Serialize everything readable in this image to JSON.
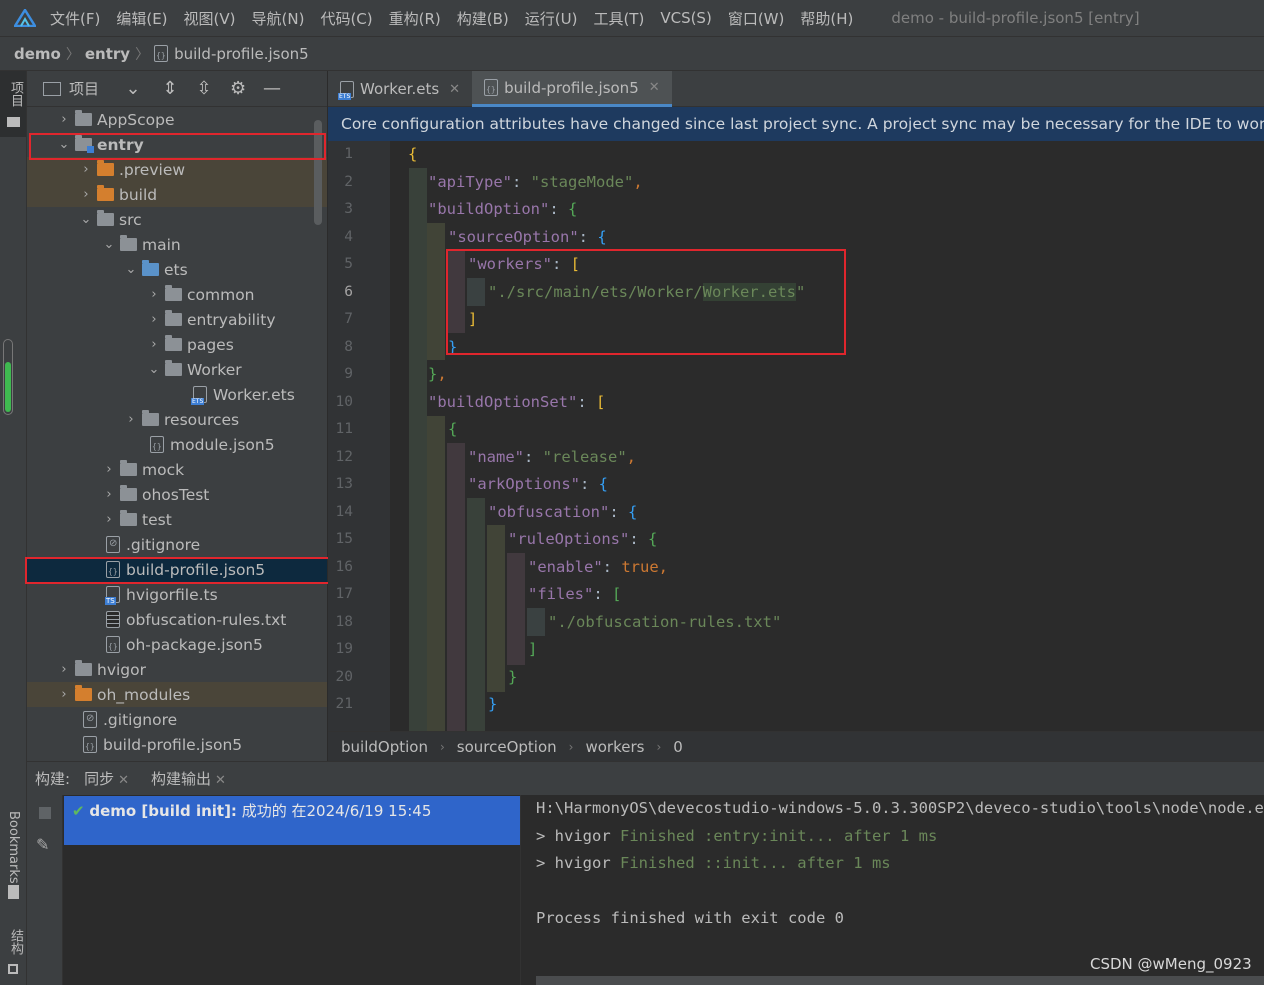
{
  "menu": {
    "items": [
      "文件(F)",
      "编辑(E)",
      "视图(V)",
      "导航(N)",
      "代码(C)",
      "重构(R)",
      "构建(B)",
      "运行(U)",
      "工具(T)",
      "VCS(S)",
      "窗口(W)",
      "帮助(H)"
    ],
    "window_title": "demo - build-profile.json5 [entry]"
  },
  "breadcrumb": {
    "project": "demo",
    "module": "entry",
    "file": "build-profile.json5"
  },
  "left_strip": {
    "project_label": "项目",
    "bookmarks_label": "Bookmarks",
    "structure_label": "结构"
  },
  "project_panel": {
    "title": "项目",
    "tree": [
      {
        "label": "AppScope"
      },
      {
        "label": "entry"
      },
      {
        "label": ".preview"
      },
      {
        "label": "build"
      },
      {
        "label": "src"
      },
      {
        "label": "main"
      },
      {
        "label": "ets"
      },
      {
        "label": "common"
      },
      {
        "label": "entryability"
      },
      {
        "label": "pages"
      },
      {
        "label": "Worker"
      },
      {
        "label": "Worker.ets"
      },
      {
        "label": "resources"
      },
      {
        "label": "module.json5"
      },
      {
        "label": "mock"
      },
      {
        "label": "ohosTest"
      },
      {
        "label": "test"
      },
      {
        "label": ".gitignore"
      },
      {
        "label": "build-profile.json5"
      },
      {
        "label": "hvigorfile.ts"
      },
      {
        "label": "obfuscation-rules.txt"
      },
      {
        "label": "oh-package.json5"
      },
      {
        "label": "hvigor"
      },
      {
        "label": "oh_modules"
      },
      {
        "label": ".gitignore"
      },
      {
        "label": "build-profile.json5"
      }
    ]
  },
  "editor": {
    "tabs": [
      "Worker.ets",
      "build-profile.json5"
    ],
    "active_tab": "build-profile.json5",
    "banner": "Core configuration attributes have changed since last project sync. A project sync may be necessary for the IDE to work properly.",
    "line_numbers": [
      "1",
      "2",
      "3",
      "4",
      "5",
      "6",
      "7",
      "8",
      "9",
      "10",
      "11",
      "12",
      "13",
      "14",
      "15",
      "16",
      "17",
      "18",
      "19",
      "20",
      "21"
    ],
    "current_line": "6",
    "code": {
      "l1": "{",
      "l2_key": "\"apiType\"",
      "l2_val": "\"stageMode\"",
      "l3_key": "\"buildOption\"",
      "l4_key": "\"sourceOption\"",
      "l5_key": "\"workers\"",
      "l6_val_a": "\"./src/main/ets/Worker/",
      "l6_val_b": "Worker.ets",
      "l6_val_c": "\"",
      "l10_key": "\"buildOptionSet\"",
      "l12_key": "\"name\"",
      "l12_val": "\"release\"",
      "l13_key": "\"arkOptions\"",
      "l14_key": "\"obfuscation\"",
      "l15_key": "\"ruleOptions\"",
      "l16_key": "\"enable\"",
      "l16_val": "true",
      "l17_key": "\"files\"",
      "l18_val": "\"./obfuscation-rules.txt\""
    },
    "breadcrumb": [
      "buildOption",
      "sourceOption",
      "workers",
      "0"
    ]
  },
  "build": {
    "label": "构建:",
    "tabs": [
      "同步",
      "构建输出"
    ],
    "result_title": "demo [build init]:",
    "result_text": "成功的 在2024/6/19 15:45",
    "console": [
      "H:\\HarmonyOS\\devecostudio-windows-5.0.3.300SP2\\deveco-studio\\tools\\node\\node.exe",
      "> hvigor ",
      "Finished :entry:init... after 1 ms",
      "> hvigor ",
      "Finished ::init... after 1 ms",
      "Process finished with exit code 0"
    ]
  },
  "watermark": "CSDN @wMeng_0923",
  "colors": {
    "accent": "#4a88c7",
    "highlight_box": "#e0262d",
    "banner": "#1e3a5f",
    "selection": "#2f65ca"
  }
}
